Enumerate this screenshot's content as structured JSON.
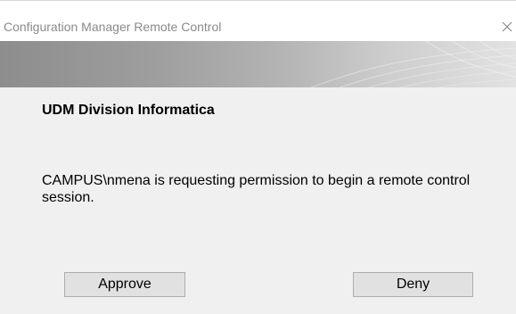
{
  "window": {
    "title": "Configuration Manager Remote Control",
    "close_icon": "close-icon"
  },
  "banner": {
    "decoration": "swoosh-lines"
  },
  "dialog": {
    "organization": "UDM Division Informatica",
    "message": "CAMPUS\\nmena is requesting permission to begin a remote control session.",
    "approve_label": "Approve",
    "deny_label": "Deny"
  }
}
